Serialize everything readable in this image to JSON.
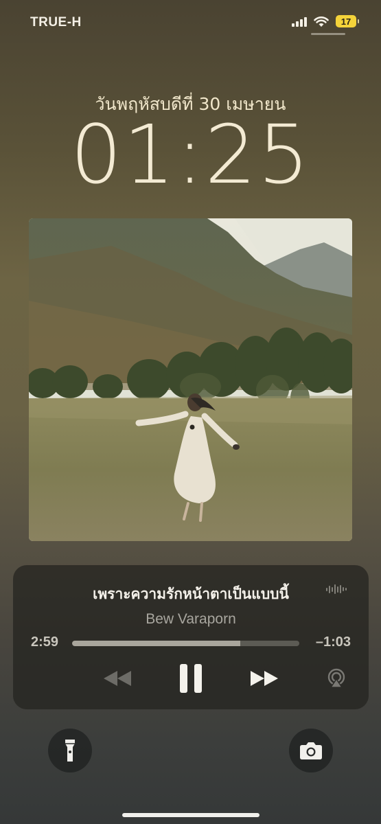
{
  "status_bar": {
    "carrier": "TRUE-H",
    "battery_level": "17",
    "icons": [
      "signal-bars-icon",
      "wifi-icon",
      "battery-icon"
    ]
  },
  "lock_screen": {
    "date": "วันพฤหัสบดีที่ 30 เมษายน",
    "time": "01:25"
  },
  "now_playing": {
    "title": "เพราะความรักหน้าตาเป็นแบบนี้",
    "artist": "Bew Varaporn",
    "elapsed": "2:59",
    "remaining": "–1:03",
    "progress_fraction": 0.74,
    "controls": [
      "rewind-icon",
      "pause-icon",
      "fast-forward-icon",
      "airplay-icon"
    ]
  },
  "quick_actions": {
    "left": "flashlight-icon",
    "right": "camera-icon"
  },
  "colors": {
    "battery": "#f4d33a",
    "clock_text": "#f3ead3",
    "player_bg": "#22221e"
  }
}
